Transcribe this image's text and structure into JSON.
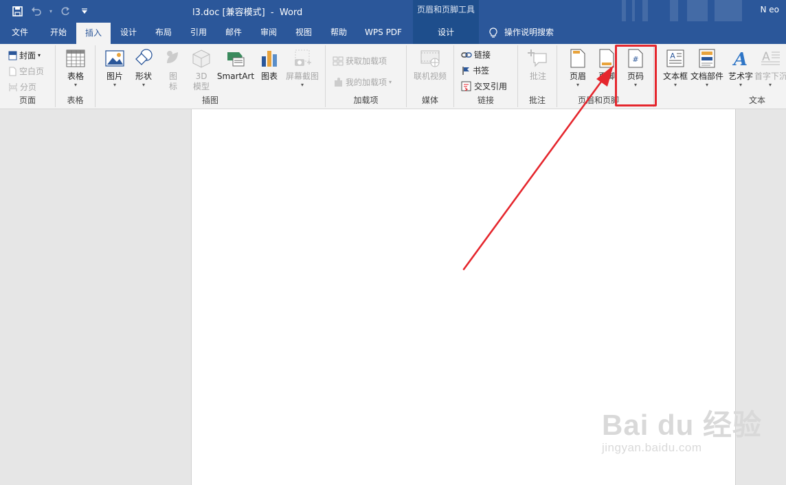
{
  "title_bar": {
    "document_title": "l3.doc [兼容模式]  -  Word",
    "context_tool_title": "页眉和页脚工具",
    "user": "N eo"
  },
  "tabs": [
    "文件",
    "开始",
    "插入",
    "设计",
    "布局",
    "引用",
    "邮件",
    "审阅",
    "视图",
    "帮助",
    "WPS PDF"
  ],
  "active_tab": "插入",
  "context_tab": "设计",
  "tell_me": "操作说明搜索",
  "groups": {
    "pages": {
      "label": "页面",
      "cover": "封面",
      "blank": "空白页",
      "break": "分页"
    },
    "tables": {
      "label": "表格",
      "table": "表格"
    },
    "illustrations": {
      "label": "插图",
      "picture": "图片",
      "shapes": "形状",
      "icons_top": "图",
      "icons_bottom": "标",
      "model_top": "3D",
      "model_bottom": "模型",
      "smartart": "SmartArt",
      "chart": "图表",
      "screenshot": "屏幕截图"
    },
    "addins": {
      "label": "加载项",
      "get": "获取加载项",
      "mine": "我的加载项"
    },
    "media": {
      "label": "媒体",
      "video": "联机视频"
    },
    "links": {
      "label": "链接",
      "link": "链接",
      "bookmark": "书签",
      "crossref": "交叉引用"
    },
    "comments": {
      "label": "批注",
      "comment": "批注"
    },
    "header_footer": {
      "label": "页眉和页脚",
      "header": "页眉",
      "footer": "页脚",
      "page_number": "页码"
    },
    "text": {
      "label": "文本",
      "textbox": "文本框",
      "quickparts": "文档部件",
      "wordart": "艺术字",
      "dropcap": "首字下沉"
    }
  },
  "watermark": {
    "main": "Bai du 经验",
    "sub": "jingyan.baidu.com"
  },
  "colors": {
    "titlebar": "#2b579a",
    "context": "#1e4e8c",
    "ribbon": "#f3f3f3",
    "highlight": "#e5262d"
  }
}
